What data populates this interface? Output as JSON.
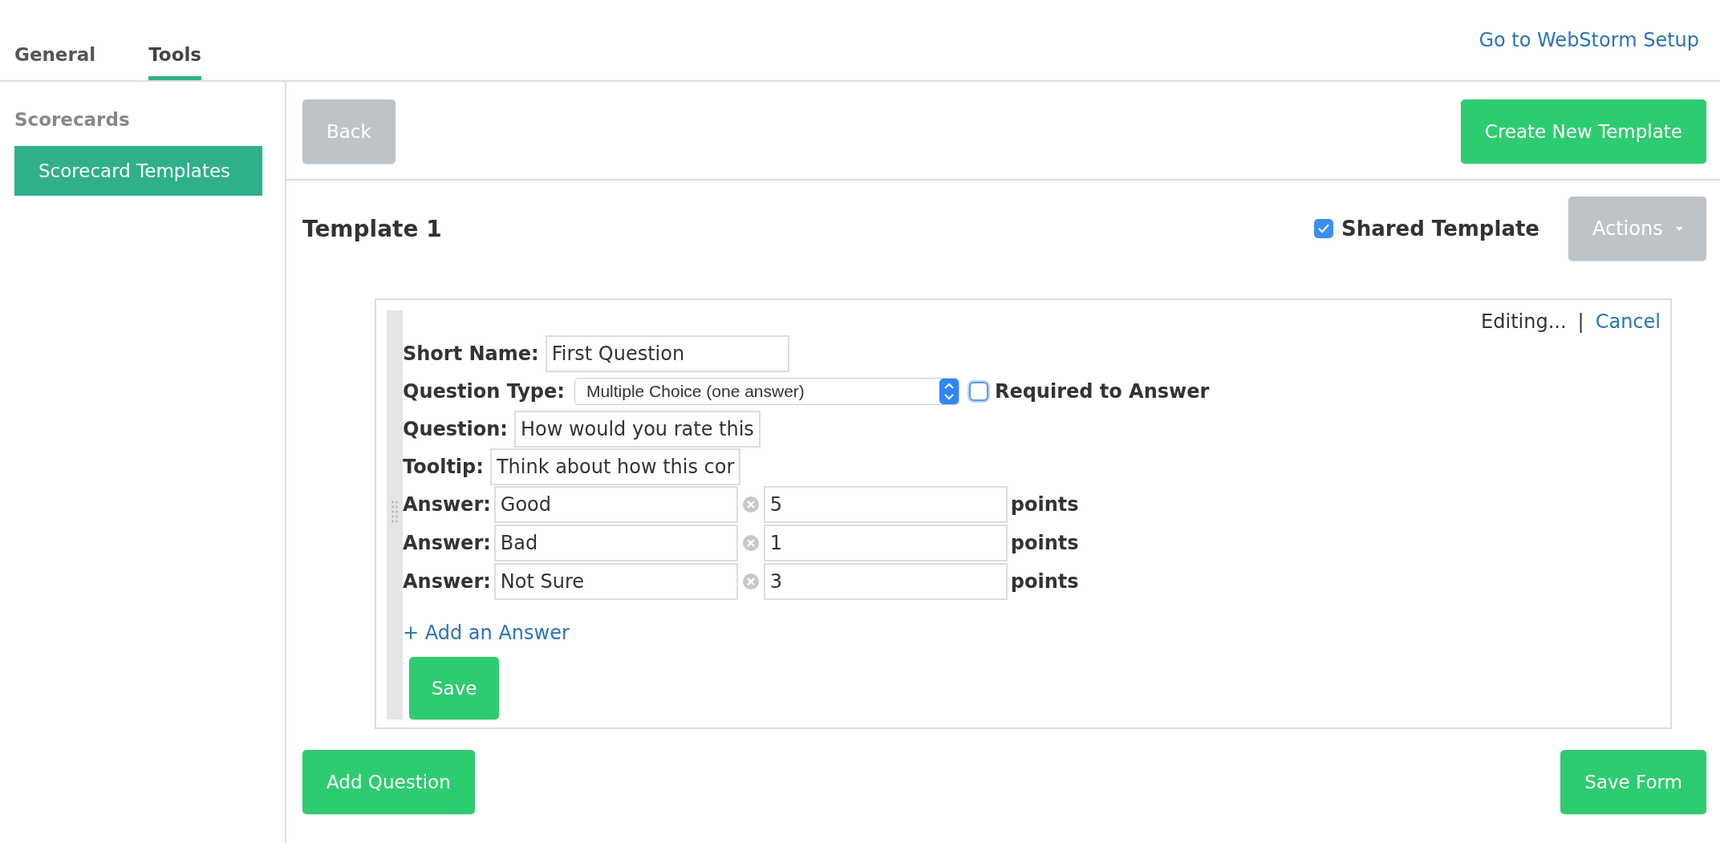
{
  "tabs": [
    {
      "label": "General",
      "selected": false
    },
    {
      "label": "Tools",
      "selected": true
    }
  ],
  "header_link": "Go to WebStorm Setup",
  "sidebar": {
    "heading": "Scorecards",
    "items": [
      {
        "label": "Scorecard Templates",
        "selected": true
      }
    ]
  },
  "toolbar": {
    "back": "Back",
    "create": "Create New Template"
  },
  "template": {
    "title": "Template 1",
    "shared": {
      "label": "Shared Template",
      "checked": true
    },
    "actions": "Actions"
  },
  "editor": {
    "status": "Editing...",
    "separator": "|",
    "cancel": "Cancel",
    "short_name": {
      "label": "Short Name:",
      "value": "First Question"
    },
    "question_type": {
      "label": "Question Type:",
      "value": "Multiple Choice (one answer)"
    },
    "required": {
      "label": "Required to Answer",
      "checked": false
    },
    "question": {
      "label": "Question:",
      "value": "How would you rate this"
    },
    "tooltip": {
      "label": "Tooltip:",
      "value": "Think about how this cor"
    },
    "answers": [
      {
        "label": "Answer:",
        "value": "Good",
        "points": "5",
        "unit": "points"
      },
      {
        "label": "Answer:",
        "value": "Bad",
        "points": "1",
        "unit": "points"
      },
      {
        "label": "Answer:",
        "value": "Not Sure",
        "points": "3",
        "unit": "points"
      }
    ],
    "add_answer": "+ Add an Answer",
    "save": "Save"
  },
  "footer": {
    "add_question": "Add Question",
    "save_form": "Save Form"
  }
}
